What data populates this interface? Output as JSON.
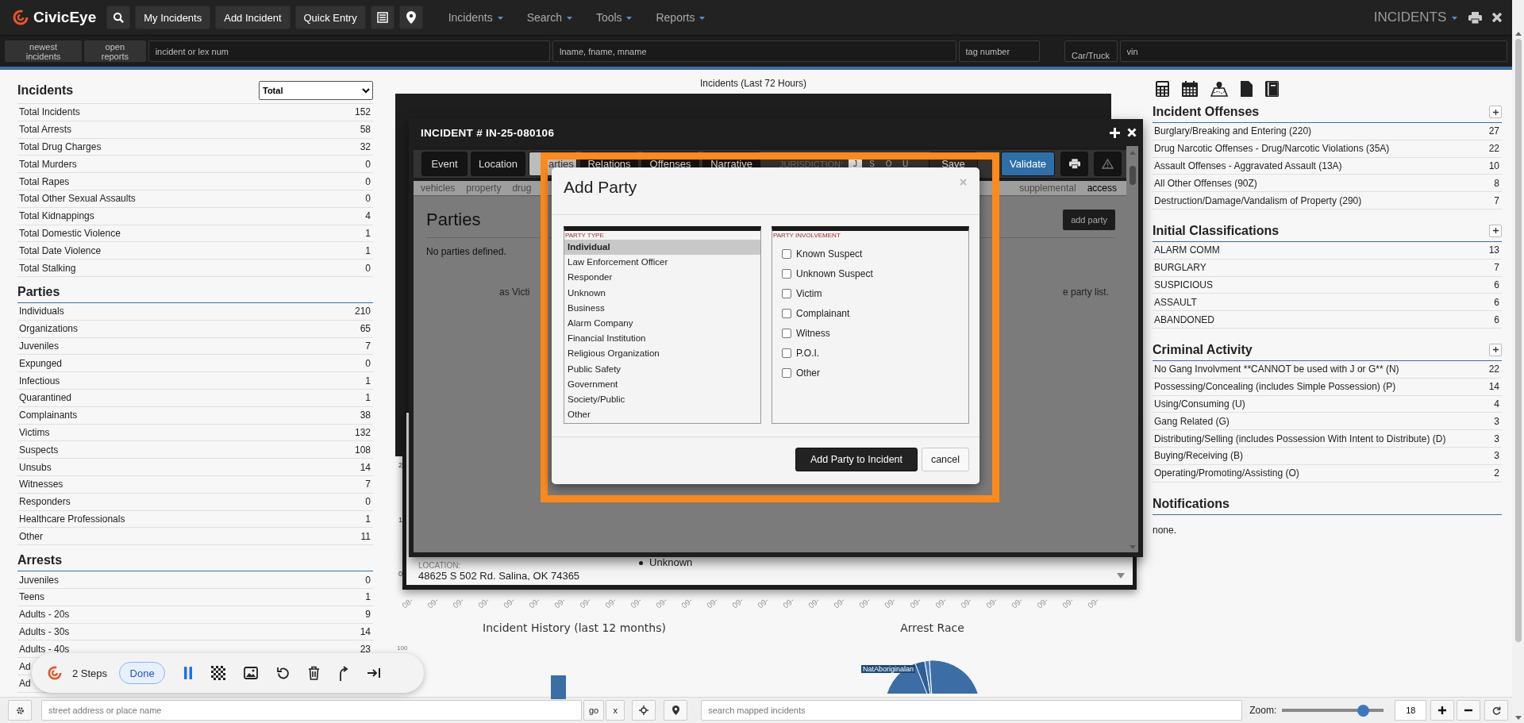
{
  "topbar": {
    "brand": "CivicEye",
    "buttons": [
      {
        "kind": "search"
      },
      {
        "kind": "text",
        "label": "My Incidents"
      },
      {
        "kind": "text",
        "label": "Add Incident"
      },
      {
        "kind": "text",
        "label": "Quick Entry"
      },
      {
        "kind": "list"
      },
      {
        "kind": "pin"
      }
    ],
    "menus": [
      "Incidents",
      "Search",
      "Tools",
      "Reports"
    ],
    "module": "INCIDENTS"
  },
  "searchbar": {
    "buttons": [
      "newest incidents",
      "open reports"
    ],
    "fields": [
      {
        "placeholder": "incident or lex num"
      },
      {
        "placeholder": "lname, fname, mname"
      },
      {
        "placeholder": "tag number"
      },
      {
        "placeholder": "Car/Truck"
      },
      {
        "placeholder": "vin"
      }
    ]
  },
  "left": {
    "sections": [
      {
        "title": "Incidents",
        "select": "Total",
        "rows": [
          {
            "label": "Total Incidents",
            "count": "152"
          },
          {
            "label": "Total Arrests",
            "count": "58"
          },
          {
            "label": "Total Drug Charges",
            "count": "32"
          },
          {
            "label": "Total Murders",
            "count": "0"
          },
          {
            "label": "Total Rapes",
            "count": "0"
          },
          {
            "label": "Total Other Sexual Assaults",
            "count": "0"
          },
          {
            "label": "Total Kidnappings",
            "count": "4"
          },
          {
            "label": "Total Domestic Violence",
            "count": "1"
          },
          {
            "label": "Total Date Violence",
            "count": "1"
          },
          {
            "label": "Total Stalking",
            "count": "0"
          }
        ]
      },
      {
        "title": "Parties",
        "rows": [
          {
            "label": "Individuals",
            "count": "210"
          },
          {
            "label": "Organizations",
            "count": "65"
          },
          {
            "label": "Juveniles",
            "count": "7"
          },
          {
            "label": "Expunged",
            "count": "0"
          },
          {
            "label": "Infectious",
            "count": "1"
          },
          {
            "label": "Quarantined",
            "count": "1"
          },
          {
            "label": "Complainants",
            "count": "38"
          },
          {
            "label": "Victims",
            "count": "132"
          },
          {
            "label": "Suspects",
            "count": "108"
          },
          {
            "label": "Unsubs",
            "count": "14"
          },
          {
            "label": "Witnesses",
            "count": "7"
          },
          {
            "label": "Responders",
            "count": "0"
          },
          {
            "label": "Healthcare Professionals",
            "count": "1"
          },
          {
            "label": "Other",
            "count": "11"
          }
        ]
      },
      {
        "title": "Arrests",
        "rows": [
          {
            "label": "Juveniles",
            "count": "0"
          },
          {
            "label": "Teens",
            "count": "1"
          },
          {
            "label": "Adults - 20s",
            "count": "9"
          },
          {
            "label": "Adults - 30s",
            "count": "14"
          },
          {
            "label": "Adults - 40s",
            "count": "23"
          },
          {
            "label": "Ad"
          },
          {
            "label": "Ad"
          }
        ]
      }
    ]
  },
  "chart": {
    "title": "Incidents (Last 72 Hours)",
    "y_labels": [
      "2",
      "1",
      "0"
    ],
    "x_labels": [
      "08-",
      "09-",
      "09-",
      "09-",
      "09-",
      "09-",
      "09-",
      "09-",
      "09-",
      "09-",
      "09-",
      "09-",
      "09-",
      "09-",
      "09-",
      "09-",
      "09-",
      "09-",
      "09-",
      "09-",
      "09-",
      "09-",
      "09-",
      "09-",
      "09-",
      "09-",
      "09-",
      "09-"
    ]
  },
  "history_chart": {
    "title": "Incident History (last 12 months)",
    "y_label": "100"
  },
  "race_chart": {
    "title": "Arrest Race",
    "label": "NatAboriginalan"
  },
  "back_window": {
    "location_label": "LOCATION:",
    "address": "48625 S 502 Rd. Salina, OK 74365",
    "parties": [
      "Unknown"
    ]
  },
  "incident_window": {
    "title": "INCIDENT # IN-25-080106",
    "tabs": [
      {
        "label": "Event",
        "selected": false
      },
      {
        "label": "Location",
        "selected": false
      },
      {
        "label": "arties",
        "selected": true
      },
      {
        "label": "Relations",
        "selected": false
      },
      {
        "label": "Offenses",
        "selected": false
      },
      {
        "label": "Narrative",
        "selected": false
      }
    ],
    "jurisdiction_label": "JURISDICTION:",
    "jurisdictions": [
      {
        "label": "J",
        "selected": true
      },
      {
        "label": "S",
        "selected": false
      },
      {
        "label": "O",
        "selected": false
      },
      {
        "label": "U",
        "selected": false
      }
    ],
    "actions": [
      {
        "kind": "save",
        "label": "Save"
      },
      {
        "kind": "validate",
        "label": "Validate"
      },
      {
        "kind": "print"
      },
      {
        "kind": "warning"
      }
    ],
    "subtabs_left": [
      {
        "label": "vehicles",
        "selected": false
      },
      {
        "label": "property",
        "selected": false
      },
      {
        "label": "drug",
        "selected": false
      }
    ],
    "subtabs_right": [
      {
        "label": "supplemental",
        "selected": false
      },
      {
        "label": "access",
        "selected": true
      }
    ],
    "heading": "Parties",
    "add_button": "add party",
    "empty_text": "No parties defined.",
    "hint_start": "as Victi",
    "hint_end": "e party list."
  },
  "modal": {
    "title": "Add Party",
    "type_label": "PARTY TYPE",
    "types": [
      {
        "label": "Individual",
        "selected": true
      },
      {
        "label": "Law Enforcement Officer",
        "selected": false
      },
      {
        "label": "Responder",
        "selected": false
      },
      {
        "label": "Unknown",
        "selected": false
      },
      {
        "label": "Business",
        "selected": false
      },
      {
        "label": "Alarm Company",
        "selected": false
      },
      {
        "label": "Financial Institution",
        "selected": false
      },
      {
        "label": "Religious Organization",
        "selected": false
      },
      {
        "label": "Public Safety",
        "selected": false
      },
      {
        "label": "Government",
        "selected": false
      },
      {
        "label": "Society/Public",
        "selected": false
      },
      {
        "label": "Other",
        "selected": false
      }
    ],
    "involvement_label": "PARTY INVOLVEMENT",
    "involvements": [
      {
        "label": "Known Suspect",
        "checked": false
      },
      {
        "label": "Unknown Suspect",
        "checked": false
      },
      {
        "label": "Victim",
        "checked": false
      },
      {
        "label": "Complainant",
        "checked": false
      },
      {
        "label": "Witness",
        "checked": false
      },
      {
        "label": "P.O.I.",
        "checked": false
      },
      {
        "label": "Other",
        "checked": false
      }
    ],
    "buttons": [
      {
        "kind": "primary",
        "label": "Add Party to Incident"
      },
      {
        "kind": "secondary",
        "label": "cancel"
      }
    ]
  },
  "right": {
    "sections": [
      {
        "title": "Incident Offenses",
        "rows": [
          {
            "label": "Burglary/Breaking and Entering (220)",
            "count": "27"
          },
          {
            "label": "Drug Narcotic Offenses - Drug/Narcotic Violations (35A)",
            "count": "22"
          },
          {
            "label": "Assault Offenses - Aggravated Assault (13A)",
            "count": "10"
          },
          {
            "label": "All Other Offenses (90Z)",
            "count": "8"
          },
          {
            "label": "Destruction/Damage/Vandalism of Property (290)",
            "count": "7"
          }
        ]
      },
      {
        "title": "Initial Classifications",
        "rows": [
          {
            "label": "ALARM COMM",
            "count": "13"
          },
          {
            "label": "BURGLARY",
            "count": "7"
          },
          {
            "label": "SUSPICIOUS",
            "count": "6"
          },
          {
            "label": "ASSAULT",
            "count": "6"
          },
          {
            "label": "ABANDONED",
            "count": "6"
          }
        ]
      },
      {
        "title": "Criminal Activity",
        "rows": [
          {
            "label": "No Gang Involvment **CANNOT be used with J or G** (N)",
            "count": "22"
          },
          {
            "label": "Possessing/Concealing (includes Simple Possession) (P)",
            "count": "14"
          },
          {
            "label": "Using/Consuming (U)",
            "count": "4"
          },
          {
            "label": "Gang Related (G)",
            "count": "3"
          },
          {
            "label": "Distributing/Selling (includes Possession With Intent to Distribute) (D)",
            "count": "3"
          },
          {
            "label": "Buying/Receiving (B)",
            "count": "3"
          },
          {
            "label": "Operating/Promoting/Assisting (O)",
            "count": "2"
          }
        ]
      }
    ],
    "notifications": {
      "title": "Notifications",
      "text": "none."
    }
  },
  "recorder": {
    "steps": "2 Steps",
    "done": "Done"
  },
  "mapbar": {
    "address_placeholder": "street address or place name",
    "go": "go",
    "clear": "x",
    "search_placeholder": "search mapped incidents",
    "zoom_label": "Zoom:",
    "zoom": {
      "level": 0.78
    },
    "zoom_value": "18"
  }
}
